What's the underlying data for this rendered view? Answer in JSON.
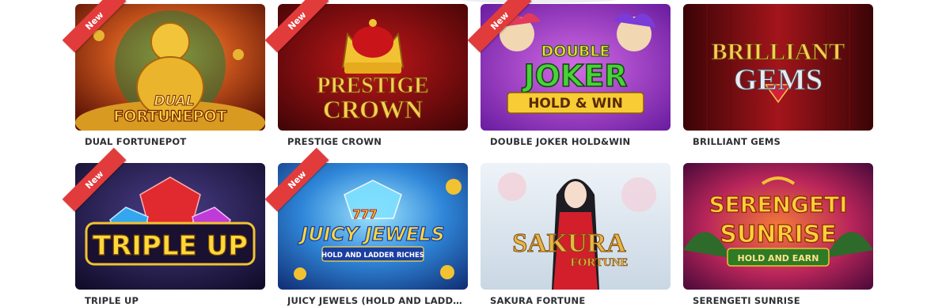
{
  "badge_label": "New",
  "games": [
    {
      "title": "DUAL FORTUNEPOT",
      "is_new": true,
      "art": [
        "DUAL",
        "FORTUNEPOT"
      ]
    },
    {
      "title": "PRESTIGE CROWN",
      "is_new": true,
      "art": [
        "PRESTIGE",
        "CROWN"
      ]
    },
    {
      "title": "DOUBLE JOKER HOLD&WIN",
      "is_new": true,
      "art": [
        "DOUBLE",
        "JOKER",
        "HOLD & WIN"
      ]
    },
    {
      "title": "BRILLIANT GEMS",
      "is_new": false,
      "art": [
        "BRILLIANT",
        "GEMS"
      ]
    },
    {
      "title": "TRIPLE UP",
      "is_new": true,
      "art": [
        "TRIPLE UP"
      ]
    },
    {
      "title": "JUICY JEWELS (HOLD AND LADDER ...",
      "is_new": true,
      "art": [
        "777",
        "JUICY JEWELS",
        "HOLD AND LADDER RICHES"
      ]
    },
    {
      "title": "SAKURA FORTUNE",
      "is_new": false,
      "art": [
        "SAKURA",
        "FORTUNE"
      ]
    },
    {
      "title": "SERENGETI SUNRISE",
      "is_new": false,
      "art": [
        "SERENGETI",
        "SUNRISE",
        "HOLD AND EARN"
      ]
    }
  ]
}
